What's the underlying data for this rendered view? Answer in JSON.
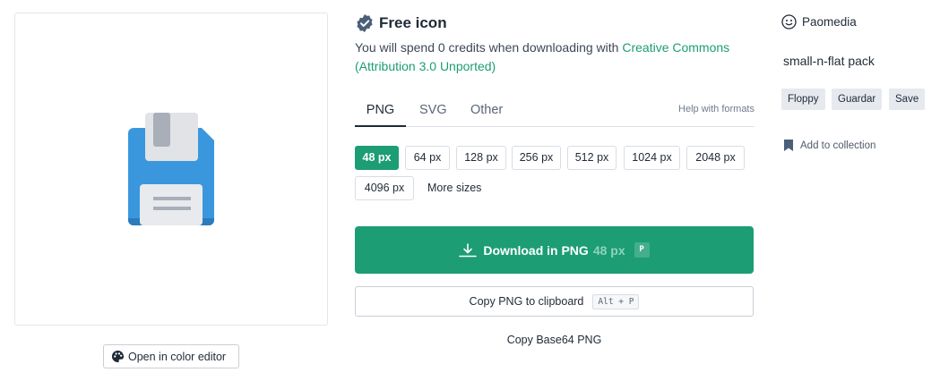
{
  "preview": {
    "icon": "floppy-disk-icon",
    "color_editor_label": "Open in color editor",
    "color_editor_icon": "palette-icon"
  },
  "license": {
    "badge_icon": "verified-badge-icon",
    "title": "Free icon",
    "text_prefix": "You will spend 0 credits when downloading with ",
    "link_text": "Creative Commons (Attribution 3.0 Unported)"
  },
  "format_tabs": [
    {
      "label": "PNG",
      "active": true
    },
    {
      "label": "SVG",
      "active": false
    },
    {
      "label": "Other",
      "active": false
    }
  ],
  "help_formats": "Help with formats",
  "sizes": [
    "48 px",
    "64 px",
    "128 px",
    "256 px",
    "512 px",
    "1024 px",
    "2048 px",
    "4096 px"
  ],
  "selected_size": "48 px",
  "more_sizes": "More sizes",
  "download": {
    "label": "Download in PNG",
    "size": "48 px",
    "shortcut": "P"
  },
  "copy": {
    "label": "Copy PNG to clipboard",
    "shortcut": "Alt + P"
  },
  "base64_label": "Copy Base64 PNG",
  "author": {
    "icon": "smiley-face-icon",
    "name": "Paomedia"
  },
  "pack": "small-n-flat pack",
  "tags": [
    "Floppy",
    "Guardar",
    "Save"
  ],
  "collection": {
    "icon": "bookmark-icon",
    "label": "Add to collection"
  },
  "colors": {
    "accent": "#1c9d74",
    "floppy_blue": "#3b97dd",
    "floppy_blue_dark": "#2b7cbd",
    "floppy_gray": "#e1e3e6"
  }
}
